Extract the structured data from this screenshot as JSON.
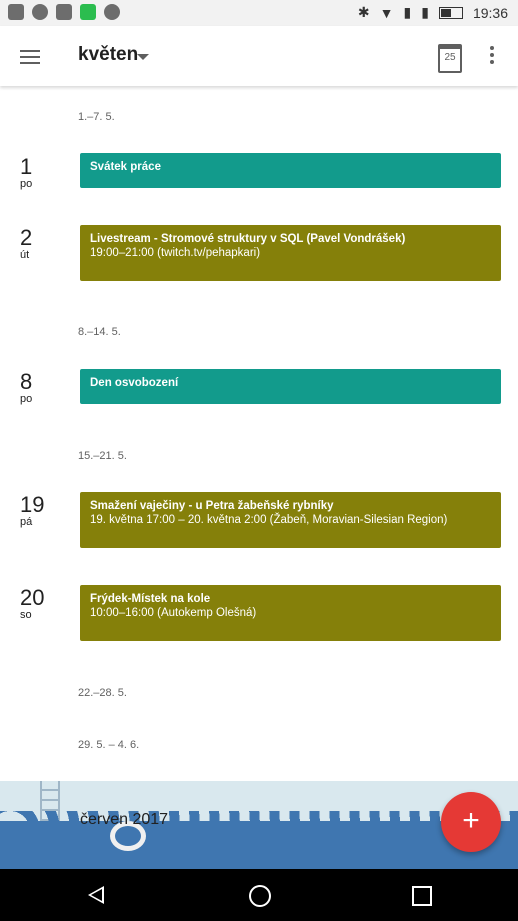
{
  "status_bar": {
    "time": "19:36",
    "icons": [
      "hashtag-icon",
      "sync-icon",
      "image-icon",
      "app-icon",
      "shield-icon",
      "bluetooth-icon",
      "wifi-icon",
      "signal-icon",
      "signal-icon",
      "battery-icon"
    ]
  },
  "header": {
    "title": "květen",
    "calendar_day": "25"
  },
  "weeks": [
    {
      "label": "1.–7. 5."
    },
    {
      "label": "8.–14. 5."
    },
    {
      "label": "15.–21. 5."
    },
    {
      "label": "22.–28. 5."
    },
    {
      "label": "29. 5. – 4. 6."
    }
  ],
  "days": [
    {
      "num": "1",
      "dow": "po"
    },
    {
      "num": "2",
      "dow": "út"
    },
    {
      "num": "8",
      "dow": "po"
    },
    {
      "num": "19",
      "dow": "pá"
    },
    {
      "num": "20",
      "dow": "so"
    }
  ],
  "events": [
    {
      "title": "Svátek práce",
      "subtitle": "",
      "color": "#129b8c"
    },
    {
      "title": "Livestream - Stromové struktury v SQL (Pavel Vondrášek)",
      "subtitle": "19:00–21:00 (twitch.tv/pehapkari)",
      "color": "#85800a"
    },
    {
      "title": "Den osvobození",
      "subtitle": "",
      "color": "#129b8c"
    },
    {
      "title": "Smažení vaječiny - u Petra  žabeňské rybníky",
      "subtitle": "19. května 17:00 – 20. května 2:00 (Žabeň, Moravian-Silesian Region)",
      "color": "#85800a"
    },
    {
      "title": "Frýdek-Místek na kole",
      "subtitle": "10:00–16:00 (Autokemp Olešná)",
      "color": "#85800a"
    }
  ],
  "next_month": {
    "title": "červen 2017"
  },
  "fab": {
    "label": "+"
  },
  "colors": {
    "accent": "#e53935",
    "teal": "#129b8c",
    "olive": "#85800a"
  }
}
